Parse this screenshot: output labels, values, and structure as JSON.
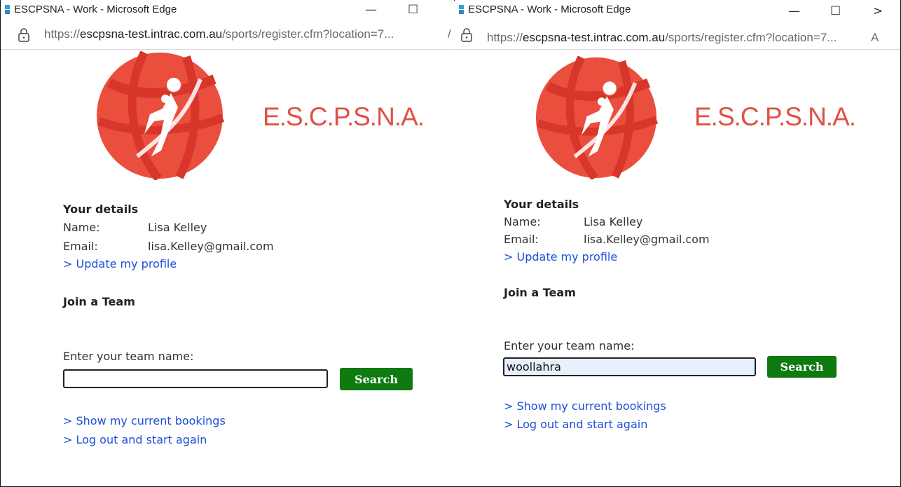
{
  "left": {
    "window_title": "ESCPSNA - Work - Microsoft Edge",
    "controls": {
      "minimize": "—",
      "maximize": "☐"
    },
    "url_scheme": "https://",
    "url_host": "escpsna-test.intrac.com.au",
    "url_path": "/sports/register.cfm?location=7...",
    "url_overflow": "/",
    "brand": "E.S.C.P.S.N.A.",
    "details_heading": "Your details",
    "name_label": "Name:",
    "name_value": "Lisa Kelley",
    "email_label": "Email:",
    "email_value": "lisa.Kelley@gmail.com",
    "update_link": "> Update my profile",
    "join_heading": "Join a Team",
    "team_prompt": "Enter your team name:",
    "team_value": "",
    "search_label": "Search",
    "bookings_link": "> Show my current bookings",
    "logout_link": "> Log out and start again"
  },
  "right": {
    "window_title": "ESCPSNA - Work - Microsoft Edge",
    "controls": {
      "minimize": "—",
      "maximize": "☐",
      "close": ">"
    },
    "url_scheme": "https://",
    "url_host": "escpsna-test.intrac.com.au",
    "url_path": "/sports/register.cfm?location=7...",
    "url_overflow": "A",
    "brand": "E.S.C.P.S.N.A.",
    "details_heading": "Your details",
    "name_label": "Name:",
    "name_value": "Lisa Kelley",
    "email_label": "Email:",
    "email_value": "lisa.Kelley@gmail.com",
    "update_link": "> Update my profile",
    "join_heading": "Join a Team",
    "team_prompt": "Enter your team name:",
    "team_value": "woollahra",
    "search_label": "Search",
    "bookings_link": "> Show my current bookings",
    "logout_link": "> Log out and start again"
  },
  "colors": {
    "brand": "#e05045",
    "logo": "#ea4f3d",
    "button": "#0e7a10",
    "link": "#1d4ed8"
  },
  "icons": [
    "edge-app-icon",
    "minimize-icon",
    "maximize-icon",
    "close-icon",
    "lock-icon",
    "netball-logo"
  ]
}
